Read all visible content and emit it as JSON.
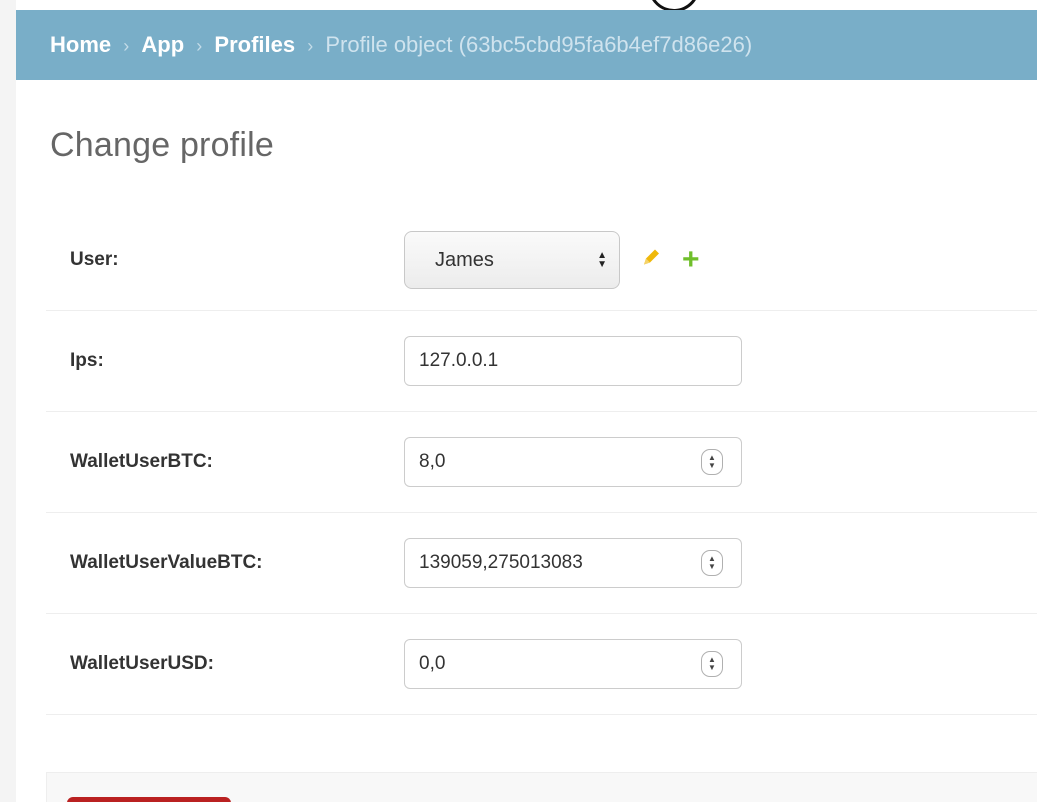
{
  "breadcrumbs": {
    "home": "Home",
    "app": "App",
    "profiles": "Profiles",
    "separator": "›",
    "current": "Profile object (63bc5cbd95fa6b4ef7d86e26)"
  },
  "page_title": "Change profile",
  "fields": {
    "user": {
      "label": "User:",
      "value": "James"
    },
    "ips": {
      "label": "Ips:",
      "value": "127.0.0.1"
    },
    "wallet_btc": {
      "label": "WalletUserBTC:",
      "value": "8,0"
    },
    "wallet_value_btc": {
      "label": "WalletUserValueBTC:",
      "value": "139059,275013083"
    },
    "wallet_usd": {
      "label": "WalletUserUSD:",
      "value": "0,0"
    }
  },
  "icons": {
    "edit": "pencil-icon",
    "add": "plus-icon",
    "select_arrows": "up-down-arrows-icon",
    "stepper": "number-stepper-icon"
  },
  "colors": {
    "breadcrumb_bg": "#79aec8",
    "add_icon": "#70bf2b",
    "edit_icon": "#efb80b",
    "delete_button": "#ba2121"
  }
}
